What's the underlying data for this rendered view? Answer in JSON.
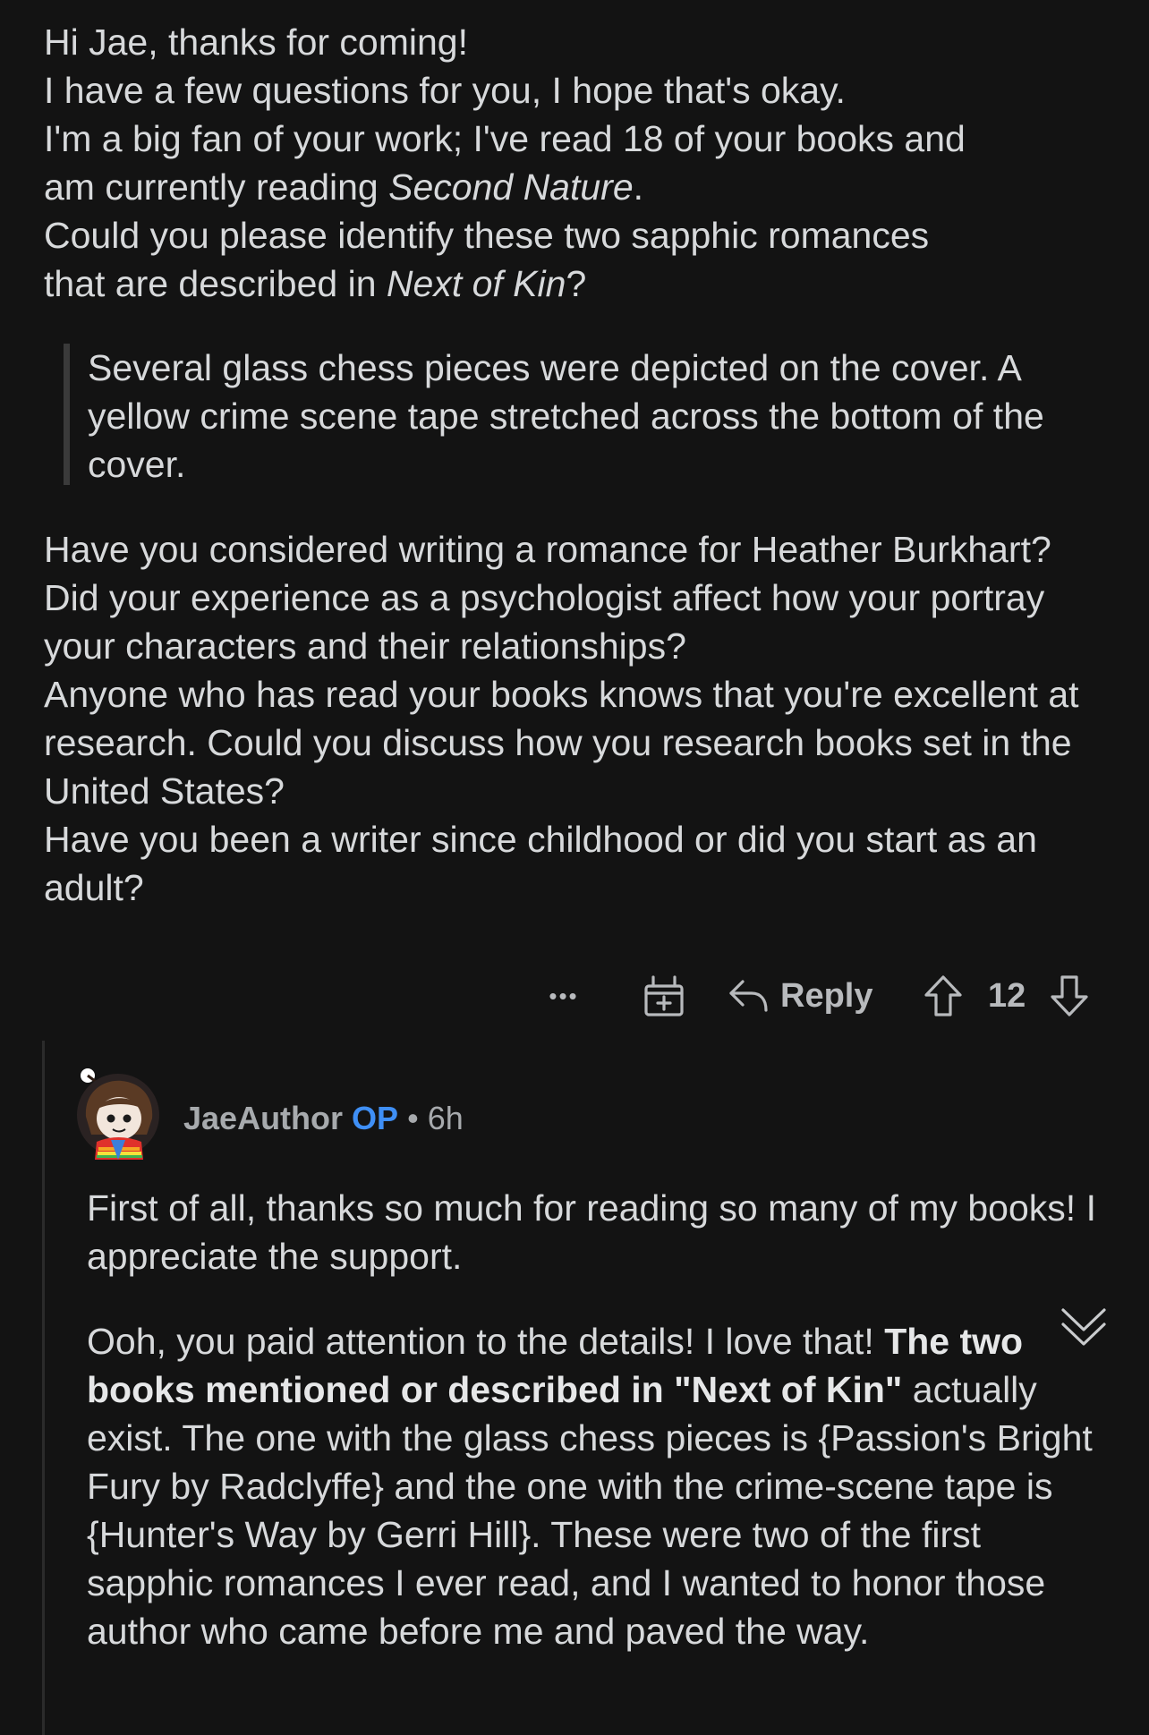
{
  "parent_comment": {
    "paragraph1_lines": [
      "Hi Jae, thanks for coming!",
      "I have a few questions for you, I hope that's okay.",
      "I'm a big fan of your work; I've read 18 of your books and",
      "Could you please identify these two sapphic romances"
    ],
    "line4_prefix": "am currently reading ",
    "line4_italic": "Second Nature",
    "line4_suffix": ".",
    "line6_prefix": "that are described in ",
    "line6_italic": "Next of Kin",
    "line6_suffix": "?",
    "quote": "Several glass chess pieces were depicted on the cover. A yellow crime scene tape stretched across the bottom of the cover.",
    "paragraph2": "Have you considered writing a romance for Heather Burkhart?\nDid your experience as a psychologist affect how your portray your characters and their relationships?\nAnyone who has read your books knows that you're excellent at research. Could you discuss how you research books set in the United States?\nHave you been a writer since childhood or did you start as an adult?"
  },
  "actions": {
    "more_label": "•••",
    "reply_label": "Reply",
    "vote_count": "12"
  },
  "reply": {
    "username": "JaeAuthor",
    "op_badge": "OP",
    "separator": "•",
    "time": "6h",
    "paragraph1": "First of all, thanks so much for reading so many of my books! I appreciate the support.",
    "p2_part1": "Ooh, you paid attention to the details! I love that! ",
    "p2_bold": "The two books mentioned or described in \"Next of Kin\"",
    "p2_part2": " actually exist. The one with the glass chess pieces is {Passion's Bright Fury by Radclyffe} and the one with the crime-scene tape is {Hunter's Way by Gerri Hill}. These were two of the first sapphic romances I ever read, and I wanted to honor those author who came before me and paved the way."
  },
  "colors": {
    "background": "#131313",
    "text": "#d7d9db",
    "op_badge": "#3f8ff5",
    "muted": "#a7aaad"
  }
}
